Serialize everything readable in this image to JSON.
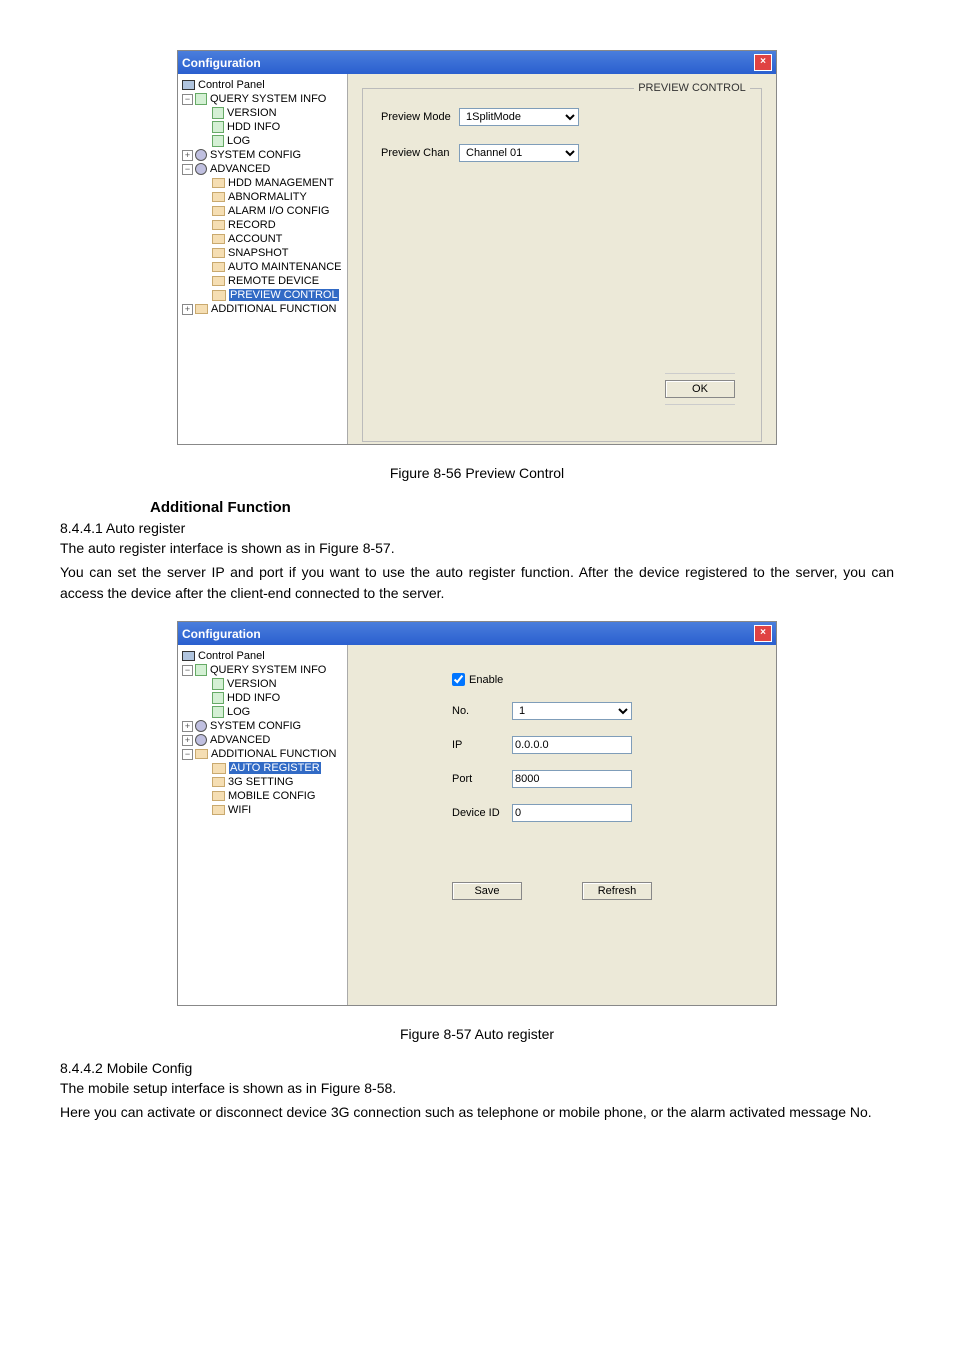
{
  "fig1": {
    "window_title": "Configuration",
    "close_glyph": "×",
    "tree": {
      "control_panel": "Control Panel",
      "query_system_info": "QUERY SYSTEM INFO",
      "version": "VERSION",
      "hdd_info": "HDD INFO",
      "log": "LOG",
      "system_config": "SYSTEM CONFIG",
      "advanced": "ADVANCED",
      "hdd_management": "HDD MANAGEMENT",
      "abnormality": "ABNORMALITY",
      "alarm_io_config": "ALARM I/O CONFIG",
      "record": "RECORD",
      "account": "ACCOUNT",
      "snapshot": "SNAPSHOT",
      "auto_maintenance": "AUTO MAINTENANCE",
      "remote_device": "REMOTE DEVICE",
      "preview_control": "PREVIEW CONTROL",
      "additional_function": "ADDITIONAL FUNCTION"
    },
    "group_title": "PREVIEW CONTROL",
    "preview_mode_label": "Preview Mode",
    "preview_mode_value": "1SplitMode",
    "preview_chan_label": "Preview Chan",
    "preview_chan_value": "Channel 01",
    "ok_label": "OK"
  },
  "caption1": "Figure 8-56 Preview Control",
  "section_title": "Additional Function",
  "sub1": "8.4.4.1   Auto register",
  "para1": "The auto register interface is shown as in Figure 8-57.",
  "para2": "You can set the server IP and port if you want to use the auto register function. After the device registered to the server, you can access the device after the client-end connected to the server.",
  "fig2": {
    "window_title": "Configuration",
    "close_glyph": "×",
    "tree": {
      "control_panel": "Control Panel",
      "query_system_info": "QUERY SYSTEM INFO",
      "version": "VERSION",
      "hdd_info": "HDD INFO",
      "log": "LOG",
      "system_config": "SYSTEM CONFIG",
      "advanced": "ADVANCED",
      "additional_function": "ADDITIONAL FUNCTION",
      "auto_register": "AUTO REGISTER",
      "tg_setting": "3G SETTING",
      "mobile_config": "MOBILE CONFIG",
      "wifi": "WIFI"
    },
    "enable_label": "Enable",
    "no_label": "No.",
    "no_value": "1",
    "ip_label": "IP",
    "ip_value": "0.0.0.0",
    "port_label": "Port",
    "port_value": "8000",
    "device_id_label": "Device ID",
    "device_id_value": "0",
    "save_label": "Save",
    "refresh_label": "Refresh"
  },
  "caption2": "Figure 8-57 Auto register",
  "sub2": "8.4.4.2  Mobile Config",
  "para3": "The mobile setup interface is shown as in Figure 8-58.",
  "para4": "Here you can activate or disconnect device 3G connection such as telephone or mobile phone, or the alarm activated message No."
}
